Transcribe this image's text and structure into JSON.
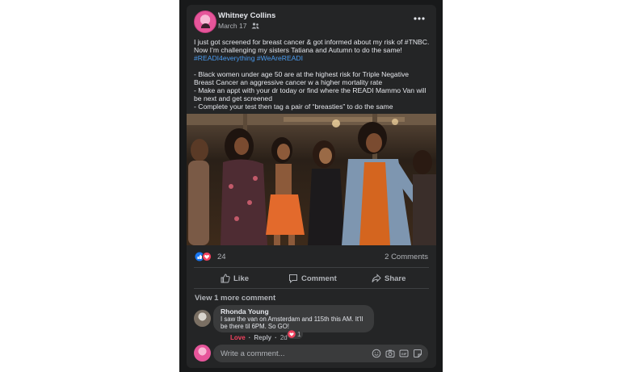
{
  "post": {
    "author": "Whitney Collins",
    "date": "March 17",
    "audience_icon": "friends-icon",
    "text_para1": "I just got screened for breast cancer & got informed about my risk of #TNBC. Now I’m challenging my sisters Tatiana and Autumn to do the same! ",
    "hashtags": "#READI4everything #WeAreREADI",
    "bullet1": "- Black women under age 50 are at the highest risk for Triple Negative Breast Cancer an aggressive cancer w a higher mortality rate",
    "bullet2": "- Make an appt with your dr today or find where the READI Mammo Van will be next and get screened",
    "bullet3": "- Complete your test then tag a pair of “breasties” to do the same"
  },
  "stats": {
    "reactions_count": "24",
    "comments_count": "2 Comments"
  },
  "actions": {
    "like": "Like",
    "comment": "Comment",
    "share": "Share"
  },
  "comments": {
    "view_more": "View 1 more comment",
    "items": [
      {
        "author": "Rhonda Young",
        "text": "I saw the van on Amsterdam and 115th this AM. It’ll be there til 6PM. So GO!",
        "reaction_count": "1",
        "love_label": "Love",
        "reply_label": "Reply",
        "separator": "·",
        "time": "2d"
      }
    ]
  },
  "composer": {
    "placeholder": "Write a comment..."
  },
  "colors": {
    "background": "#242526",
    "text": "#e4e6eb",
    "muted": "#b0b3b8",
    "link": "#4a9bf0",
    "love": "#f3425f",
    "like_blue": "#1877f2"
  }
}
